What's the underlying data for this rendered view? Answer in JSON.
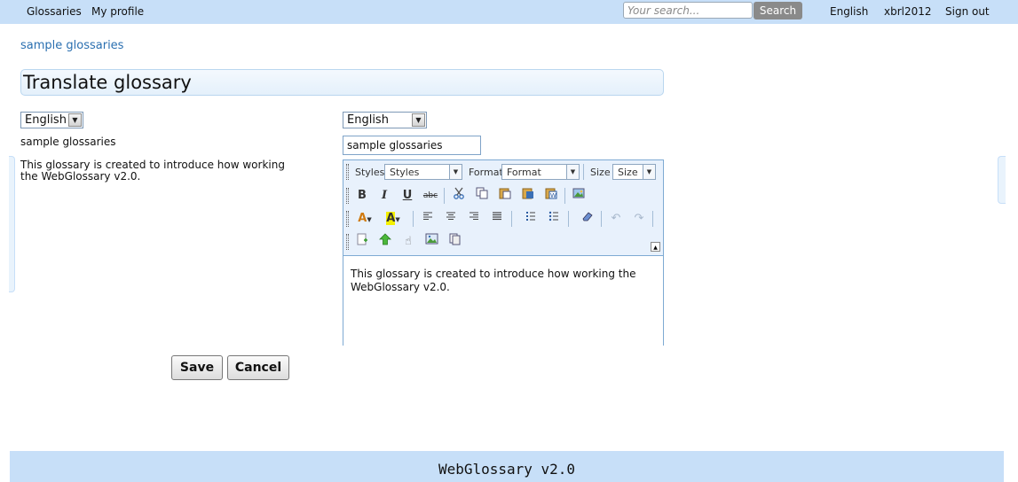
{
  "nav": {
    "glossaries": "Glossaries",
    "my_profile": "My profile",
    "language": "English",
    "user": "xbrl2012",
    "sign_out": "Sign out"
  },
  "search": {
    "placeholder": "Your search...",
    "button": "Search"
  },
  "breadcrumb": "sample glossaries",
  "page_title": "Translate glossary",
  "source": {
    "language": "English",
    "name": "sample glossaries",
    "description": "This glossary is created to introduce how working the WebGlossary v2.0."
  },
  "target": {
    "language": "English",
    "name": "sample glossaries",
    "description": "This glossary is created to introduce how working the WebGlossary v2.0."
  },
  "editor": {
    "styles_label": "Styles",
    "styles_value": "Styles",
    "format_label": "Format",
    "format_value": "Format",
    "size_label": "Size",
    "size_value": "Size",
    "bold": "B",
    "italic": "I",
    "underline": "U",
    "strike": "abc",
    "text_color": "A",
    "bg_color": "A",
    "icons": [
      "cut-icon",
      "copy-icon",
      "paste-icon",
      "paste-text-icon",
      "paste-word-icon",
      "image-icon",
      "align-left-icon",
      "align-center-icon",
      "align-right-icon",
      "align-justify-icon",
      "numbered-list-icon",
      "bulleted-list-icon",
      "remove-format-icon",
      "undo-icon",
      "redo-icon",
      "new-page-icon",
      "upload-icon",
      "hand-icon",
      "image-properties-icon",
      "templates-icon"
    ]
  },
  "actions": {
    "save": "Save",
    "cancel": "Cancel"
  },
  "footer": "WebGlossary v2.0",
  "colors": {
    "bar": "#c7dff8",
    "link": "#2a6fb0",
    "editor_border": "#7eaad3"
  }
}
